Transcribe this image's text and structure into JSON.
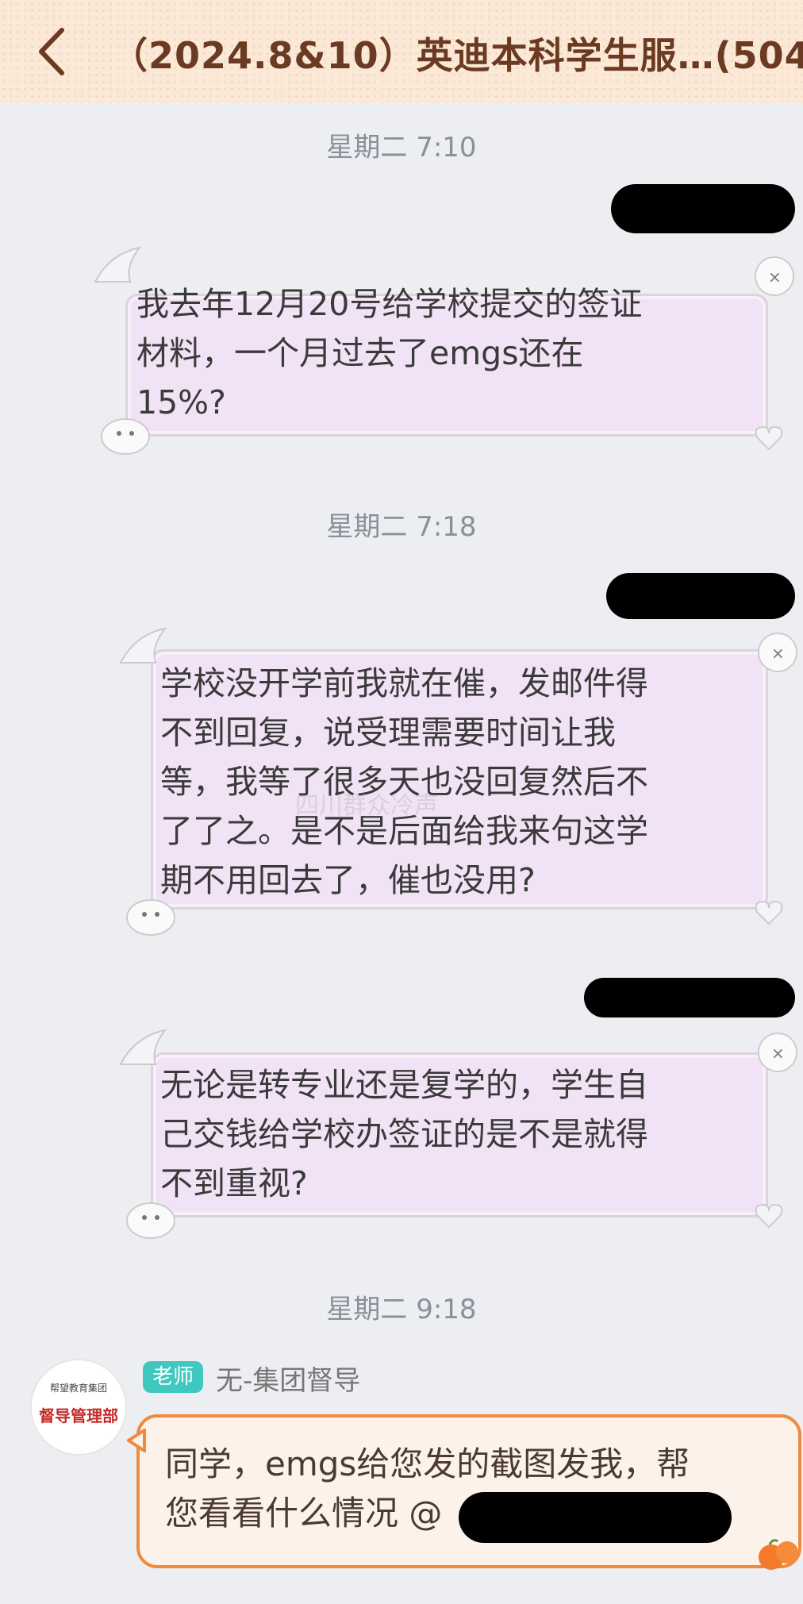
{
  "header": {
    "title": "（2024.8&10）英迪本科学生服…(504"
  },
  "timestamps": [
    "星期二 7:10",
    "星期二 7:18",
    "星期二 9:18"
  ],
  "messages": [
    {
      "text": "我去年12月20号给学校提交的签证\n材料，一个月过去了emgs还在\n15%?"
    },
    {
      "text": "学校没开学前我就在催，发邮件得\n不到回复，说受理需要时间让我\n等，我等了很多天也没回复然后不\n了了之。是不是后面给我来句这学\n期不用回去了，催也没用?"
    },
    {
      "text": "无论是转专业还是复学的，学生自\n己交钱给学校办签证的是不是就得\n不到重视?"
    }
  ],
  "teacher": {
    "avatar_top": "帮望教育集团",
    "avatar_main": "督导管理部",
    "role": "老师",
    "name": "无-集团督导",
    "text": "同学，emgs给您发的截图发我，帮\n您看看什么情况 @"
  },
  "watermark": "四川群众冷声"
}
